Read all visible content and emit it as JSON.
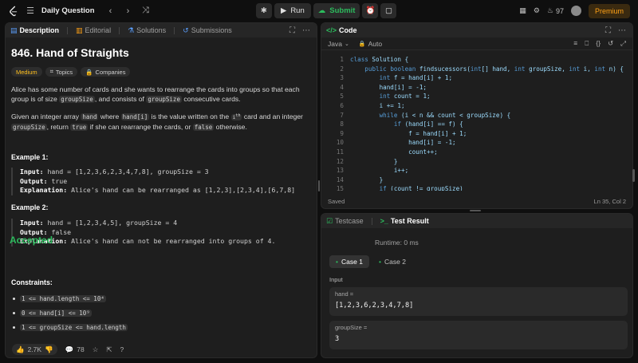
{
  "topbar": {
    "title": "Daily Question",
    "run": "Run",
    "submit": "Submit",
    "streak": "97",
    "premium": "Premium"
  },
  "desc_tabs": {
    "description": "Description",
    "editorial": "Editorial",
    "solutions": "Solutions",
    "submissions": "Submissions"
  },
  "problem": {
    "title": "846. Hand of Straights",
    "difficulty": "Medium",
    "topics": "Topics",
    "companies": "Companies",
    "p1_a": "Alice has some number of cards and she wants to rearrange the cards into groups so that each group is of size ",
    "p1_code1": "groupSize",
    "p1_b": ", and consists of ",
    "p1_code2": "groupSize",
    "p1_c": " consecutive cards.",
    "p2_a": "Given an integer array ",
    "p2_code1": "hand",
    "p2_b": " where ",
    "p2_code2": "hand[i]",
    "p2_c": " is the value written on the ",
    "p2_sup": "i",
    "p2_sup2": "th",
    "p2_d": " card and an integer ",
    "p2_code3": "groupSize",
    "p2_e": ", return ",
    "p2_code4": "true",
    "p2_f": " if she can rearrange the cards, or ",
    "p2_code5": "false",
    "p2_g": " otherwise.",
    "ex1_title": "Example 1:",
    "ex1_input_label": "Input:",
    "ex1_input": " hand = [1,2,3,6,2,3,4,7,8], groupSize = 3",
    "ex1_output_label": "Output:",
    "ex1_output": " true",
    "ex1_expl_label": "Explanation:",
    "ex1_expl": " Alice's hand can be rearranged as [1,2,3],[2,3,4],[6,7,8]",
    "ex2_title": "Example 2:",
    "ex2_input_label": "Input:",
    "ex2_input": " hand = [1,2,3,4,5], groupSize = 4",
    "ex2_output_label": "Output:",
    "ex2_output": " false",
    "ex2_expl_label": "Explanation:",
    "ex2_expl": " Alice's hand can not be rearranged into groups of 4.",
    "constraints_title": "Constraints:",
    "c1": "1 <= hand.length <= 10⁴",
    "c2": "0 <= hand[i] <= 10⁹",
    "c3": "1 <= groupSize <= hand.length"
  },
  "footer": {
    "likes": "2.7K",
    "comments": "78"
  },
  "code_panel": {
    "title": "Code",
    "language": "Java",
    "auto": "Auto",
    "saved": "Saved",
    "cursor": "Ln 35, Col 2",
    "lines": [
      {
        "n": "1",
        "text": "class Solution {"
      },
      {
        "n": "2",
        "text": "    public boolean findsucessors(int[] hand, int groupSize, int i, int n) {"
      },
      {
        "n": "3",
        "text": "        int f = hand[i] + 1;"
      },
      {
        "n": "4",
        "text": "        hand[i] = -1;"
      },
      {
        "n": "5",
        "text": "        int count = 1;"
      },
      {
        "n": "6",
        "text": "        i += 1;"
      },
      {
        "n": "7",
        "text": "        while (i < n && count < groupSize) {"
      },
      {
        "n": "8",
        "text": "            if (hand[i] == f) {"
      },
      {
        "n": "9",
        "text": "                f = hand[i] + 1;"
      },
      {
        "n": "10",
        "text": "                hand[i] = -1;"
      },
      {
        "n": "11",
        "text": "                count++;"
      },
      {
        "n": "12",
        "text": "            }"
      },
      {
        "n": "13",
        "text": "            i++;"
      },
      {
        "n": "14",
        "text": "        }"
      },
      {
        "n": "15",
        "text": "        if (count != groupSize)"
      }
    ]
  },
  "result_panel": {
    "tab_testcase": "Testcase",
    "tab_result": "Test Result",
    "status": "Accepted",
    "runtime": "Runtime: 0 ms",
    "case1": "Case 1",
    "case2": "Case 2",
    "input_label": "Input",
    "param1_name": "hand =",
    "param1_value": "[1,2,3,6,2,3,4,7,8]",
    "param2_name": "groupSize =",
    "param2_value": "3"
  }
}
